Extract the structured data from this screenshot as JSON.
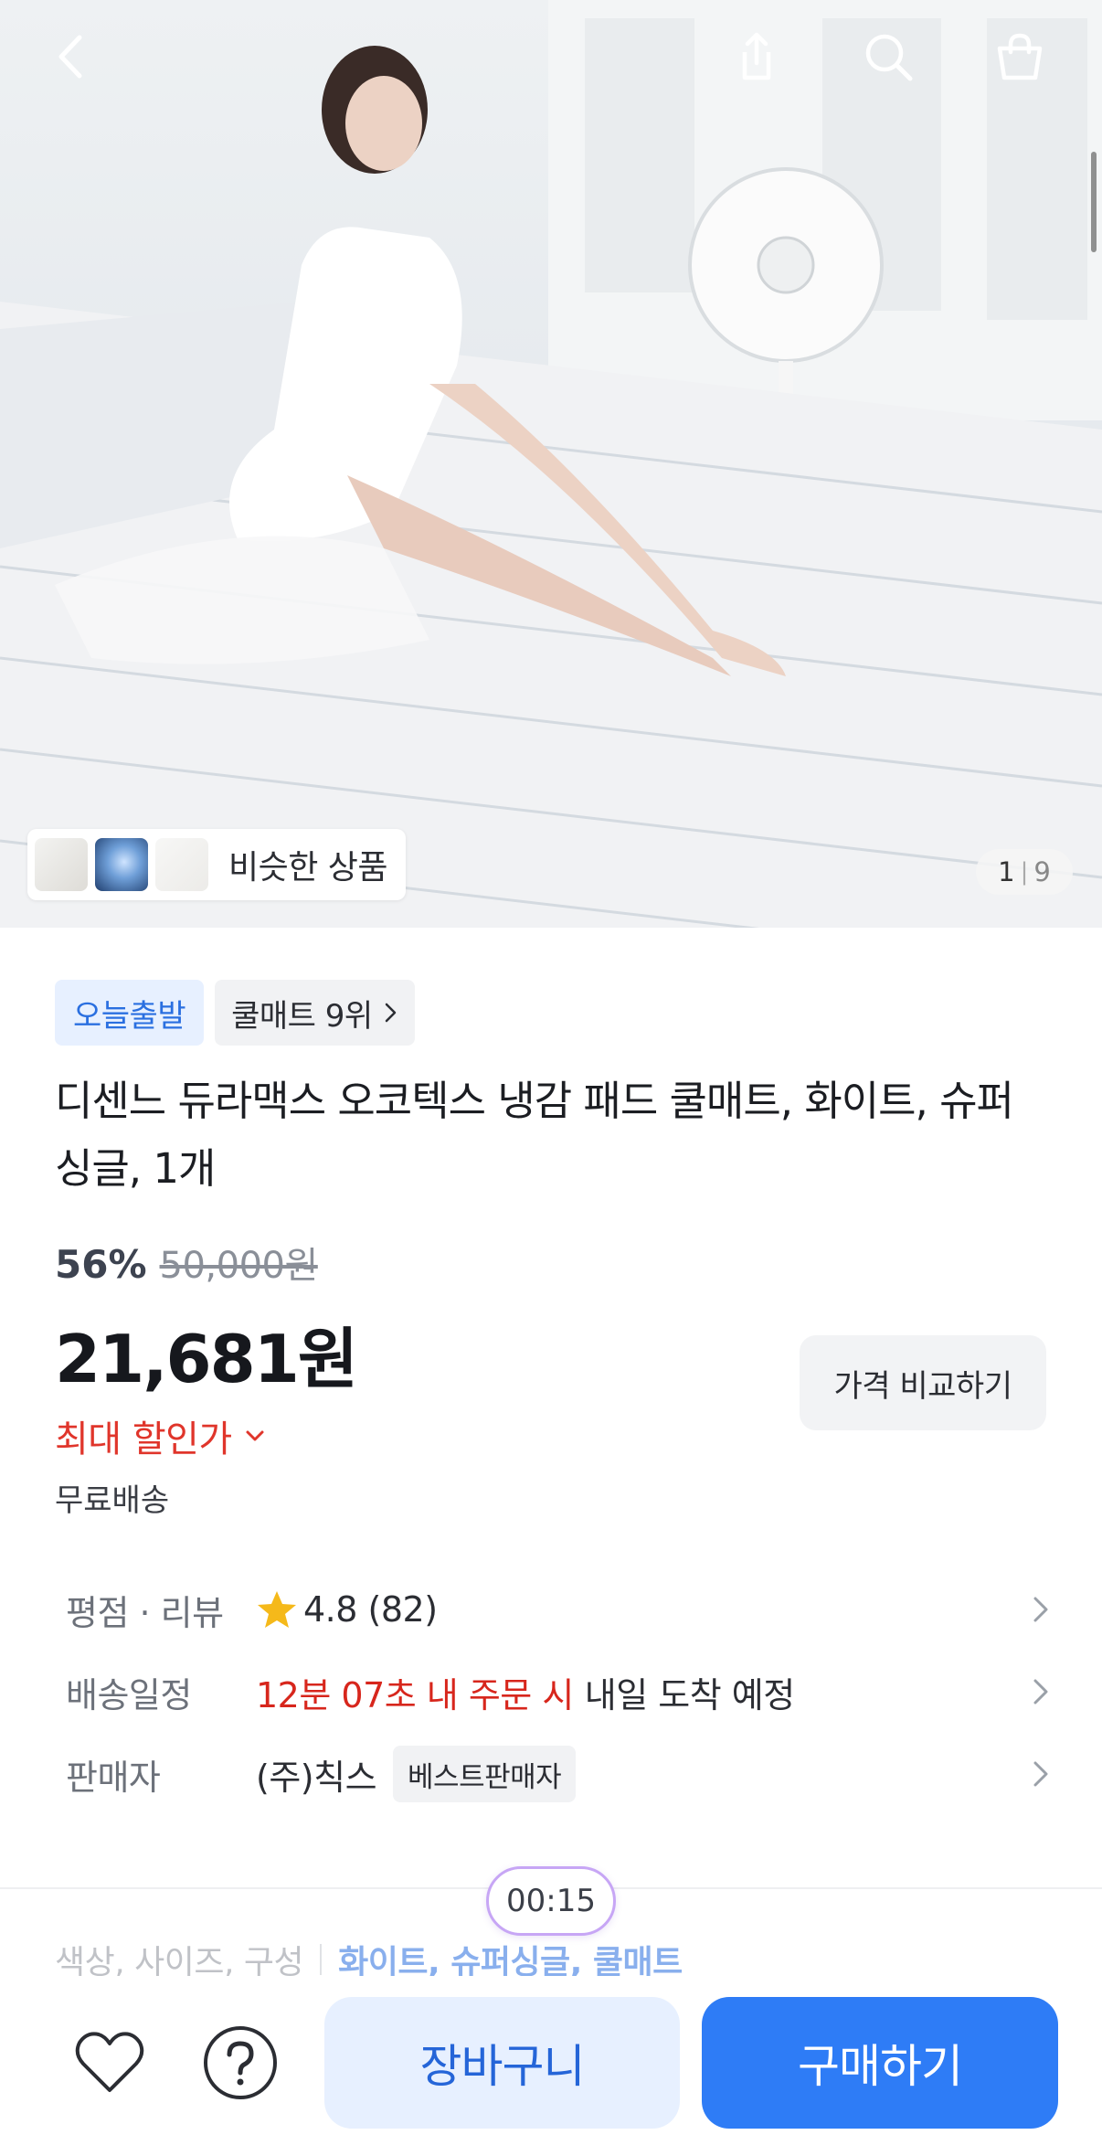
{
  "hero": {
    "image_alt": "product-photo-cool-mat",
    "counter": {
      "current": "1",
      "separator": "|",
      "total": "9"
    },
    "similar_products_label": "비슷한 상품"
  },
  "topbar": {
    "back_icon": "chevron-left-icon",
    "share_icon": "share-icon",
    "search_icon": "search-icon",
    "cart_icon": "shopping-bag-icon"
  },
  "badges": {
    "today_shipping": "오늘출발",
    "ranking": "쿨매트 9위"
  },
  "product": {
    "title": "디센느 듀라맥스 오코텍스 냉감 패드 쿨매트, 화이트, 슈퍼싱글, 1개",
    "discount_rate": "56%",
    "original_price": "50,000원",
    "sale_price": "21,681원",
    "compare_button": "가격 비교하기",
    "max_discount_label": "최대 할인가",
    "shipping": "무료배송"
  },
  "info": {
    "rating_key": "평점 · 리뷰",
    "rating_value": "4.8 (82)",
    "delivery_key": "배송일정",
    "delivery_highlight": "12분 07초 내 주문 시",
    "delivery_rest": "내일 도착 예정",
    "seller_key": "판매자",
    "seller_name": "(주)칙스",
    "seller_badge": "베스트판매자"
  },
  "options": {
    "key": "색상, 사이즈, 구성",
    "value": "화이트, 슈퍼싱글, 쿨매트"
  },
  "timer": "00:15",
  "bottom": {
    "wishlist_icon": "heart-icon",
    "inquiry_icon": "question-icon",
    "cart_label": "장바구니",
    "buy_label": "구매하기"
  },
  "colors": {
    "accent_blue": "#2e7cf6",
    "accent_light_blue": "#e7f0ff",
    "sale_red": "#e0352b",
    "delivery_red": "#d7261c",
    "star_yellow": "#f5b91a"
  }
}
